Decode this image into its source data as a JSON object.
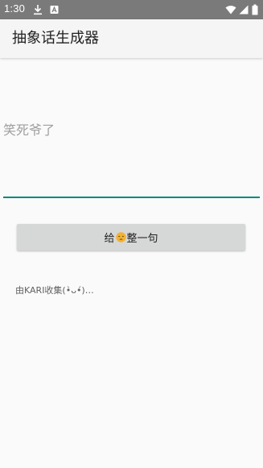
{
  "status_bar": {
    "time": "1:30",
    "icons": [
      "download-icon",
      "a-notification-icon",
      "wifi-icon",
      "signal-icon",
      "battery-icon"
    ]
  },
  "app_bar": {
    "title": "抽象话生成器"
  },
  "text_field": {
    "value": "笑死爷了"
  },
  "action_button": {
    "label_before": "给",
    "emoji": "pensive-face-emoji",
    "label_after": "整一句"
  },
  "credit": {
    "text": "由KARI收集(•̀ᴗ•́)…"
  },
  "colors": {
    "status_bar_bg": "#7a7a7a",
    "accent_underline": "#00897b",
    "button_bg": "#d6d7d7",
    "background": "#fafafa"
  }
}
